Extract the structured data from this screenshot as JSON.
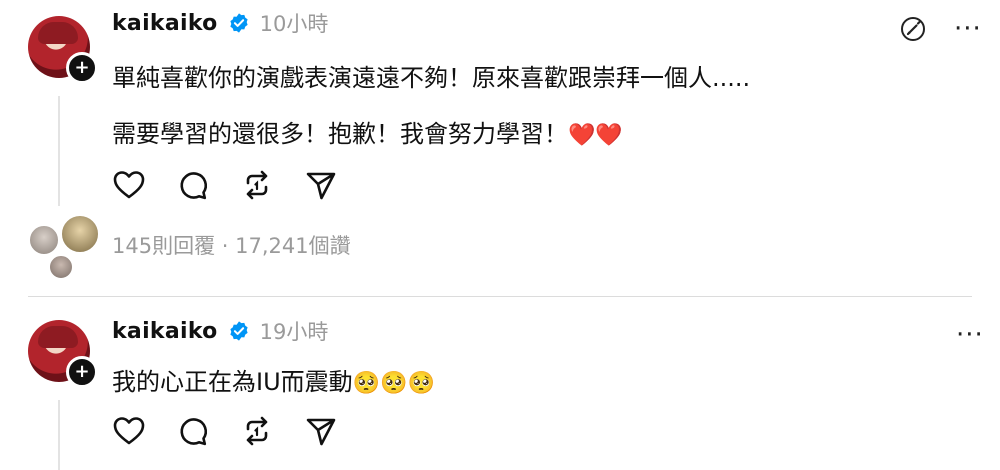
{
  "posts": [
    {
      "username": "kaikaiko",
      "time": "10小時",
      "line1": "單純喜歡你的演戲表演遠遠不夠！原來喜歡跟崇拜一個人.....",
      "line2": "需要學習的還很多！抱歉！我會努力學習！",
      "line2_emoji": "❤️❤️",
      "stats": "145則回覆 · 17,241個讚",
      "more": "···"
    },
    {
      "username": "kaikaiko",
      "time": "19小時",
      "line1": "我的心正在為IU而震動",
      "line1_emoji": "🥺🥺🥺",
      "more": "···"
    }
  ],
  "icons": {
    "verified": "verified-badge-icon",
    "follow": "plus-icon",
    "like": "heart-icon",
    "comment": "comment-icon",
    "repost": "repost-icon",
    "share": "send-icon",
    "edit": "edit-pencil-icon",
    "more": "more-icon"
  },
  "colors": {
    "verified": "#0095f6",
    "muted": "#9a9a9a",
    "heart": "#e0282e"
  }
}
